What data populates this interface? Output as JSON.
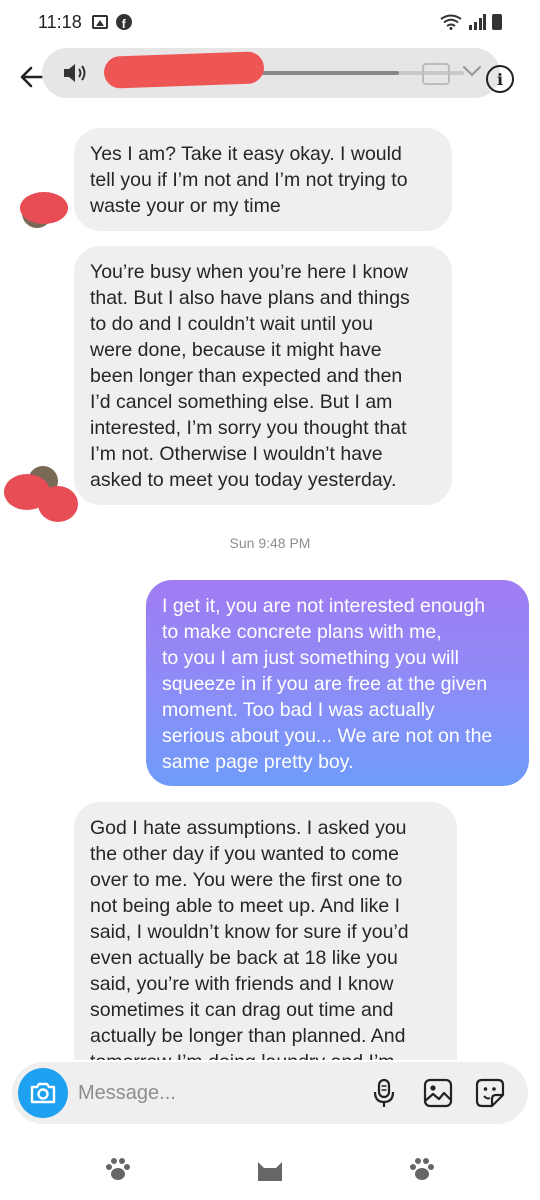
{
  "status_bar": {
    "time": "11:18",
    "icons": [
      "gallery-icon",
      "facebook-icon",
      "wifi-icon",
      "signal-icon",
      "battery-icon"
    ]
  },
  "header": {
    "media_progress": 0.82,
    "icons": [
      "back-arrow-icon",
      "speaker-icon",
      "picture-in-picture-icon",
      "chevron-down-icon",
      "info-icon"
    ]
  },
  "messages": [
    {
      "direction": "incoming",
      "text": "Yes I am? Take it easy okay. I would\ntell you if I’m not and I’m not trying to\nwaste your or my time"
    },
    {
      "direction": "incoming",
      "text": "You’re busy when you’re here I know\nthat. But I also have plans and things\nto do and I couldn’t wait until you\nwere done, because it might have\nbeen longer than expected and then\nI’d cancel something else. But I am\ninterested, I’m sorry you thought that\nI’m not. Otherwise I wouldn’t have\nasked to meet you today yesterday."
    },
    {
      "direction": "timestamp",
      "text": "Sun 9:48 PM"
    },
    {
      "direction": "outgoing",
      "text": "I get it, you are not interested enough\nto make concrete plans with me,\nto you I am just something you will\nsqueeze in if you are free at the given\nmoment. Too bad I was actually\nserious about you... We are not on the\nsame page pretty boy."
    },
    {
      "direction": "incoming",
      "text": "God I hate assumptions. I asked you\nthe other day if you wanted to come\nover to me. You were the first one to\nnot being able to meet up. And like I\nsaid, I wouldn’t know for sure if you’d\neven actually be back at 18 like you\nsaid, you’re with friends and I know\nsometimes it can drag out time and\nactually be longer than planned. And\ntomorrow I’m doing laundry and I’m"
    }
  ],
  "composer": {
    "placeholder": "Message...",
    "icons": [
      "camera-icon",
      "microphone-icon",
      "gallery-icon",
      "sticker-icon"
    ]
  },
  "bottom_nav": {
    "icons": [
      "paw-icon",
      "cat-icon",
      "paw-icon"
    ]
  },
  "colors": {
    "incoming_bubble": "#efefef",
    "outgoing_gradient_top": "#a07cf2",
    "outgoing_gradient_bottom": "#6f9bfa",
    "camera_button": "#1fa1f2",
    "redaction": "#e84c55"
  }
}
